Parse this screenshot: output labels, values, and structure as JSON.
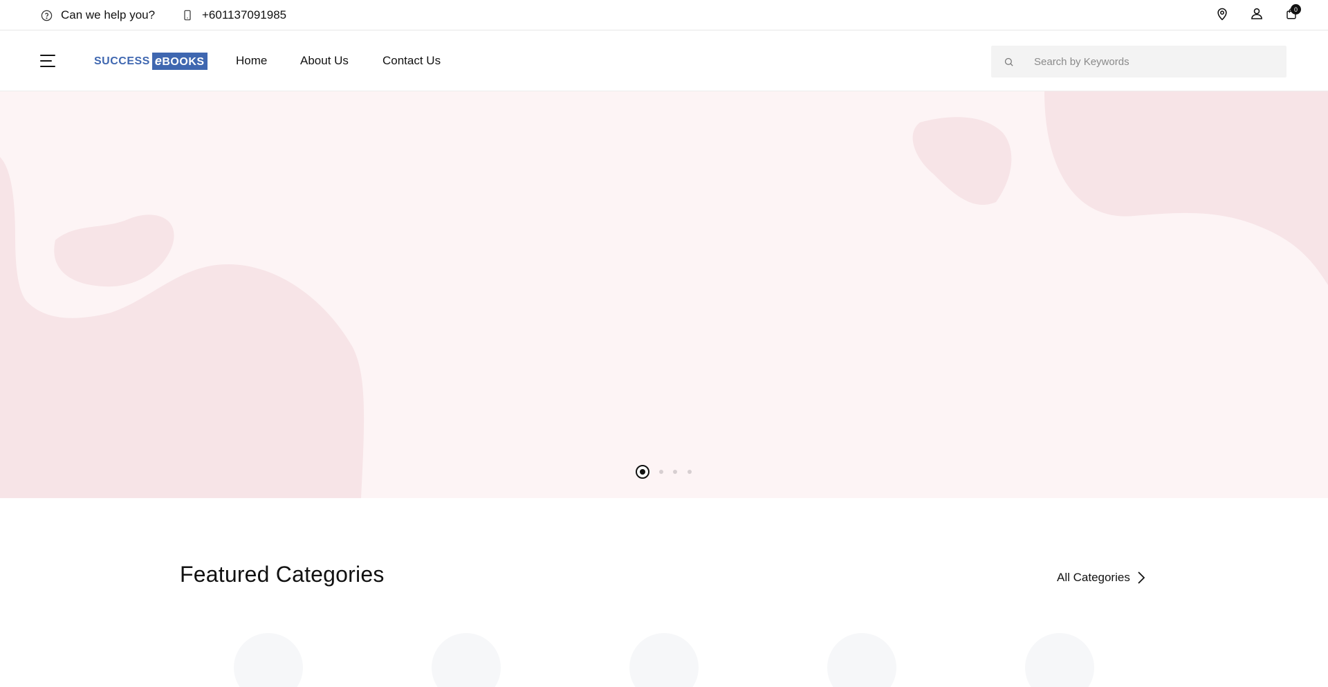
{
  "topbar": {
    "help_text": "Can we help you?",
    "phone": "+601137091985",
    "cart_count": "0",
    "icons": [
      "help-circle-icon",
      "phone-icon",
      "location-pin-icon",
      "user-icon",
      "shopping-bag-icon"
    ]
  },
  "nav": {
    "logo": {
      "part1": "SUCCESS",
      "part2_e": "e",
      "part2_rest": "BOOKS"
    },
    "links": [
      {
        "label": "Home"
      },
      {
        "label": "About Us"
      },
      {
        "label": "Contact Us"
      }
    ],
    "search": {
      "placeholder": "Search by Keywords",
      "value": ""
    }
  },
  "hero": {
    "slide_count": 4,
    "active_slide": 1,
    "colors": {
      "background": "#fdf4f5",
      "blob": "#f7e4e7"
    }
  },
  "featured": {
    "title": "Featured Categories",
    "all_link": "All Categories",
    "category_count": 5
  },
  "colors": {
    "brand": "#3f67b0",
    "text": "#111111"
  }
}
